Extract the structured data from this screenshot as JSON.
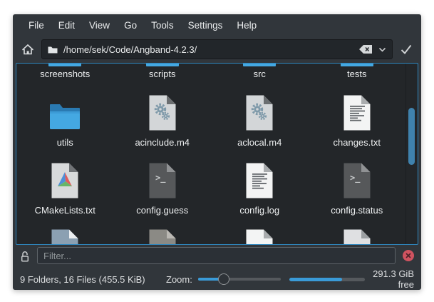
{
  "menu": {
    "items": [
      "File",
      "Edit",
      "View",
      "Go",
      "Tools",
      "Settings",
      "Help"
    ]
  },
  "location_bar": {
    "path": "/home/sek/Code/Angband-4.2.3/",
    "icons": [
      "home-icon",
      "folder-small-icon",
      "backspace-clear-icon",
      "chevron-down-icon",
      "checkmark-icon"
    ]
  },
  "file_grid": {
    "rows": [
      {
        "kind": "scrolled-top",
        "items": [
          {
            "label": "screenshots",
            "icon": "folder-strip"
          },
          {
            "label": "scripts",
            "icon": "folder-strip"
          },
          {
            "label": "src",
            "icon": "folder-strip"
          },
          {
            "label": "tests",
            "icon": "folder-strip"
          }
        ]
      },
      {
        "kind": "full",
        "items": [
          {
            "label": "utils",
            "icon": "folder"
          },
          {
            "label": "acinclude.m4",
            "icon": "gears-doc"
          },
          {
            "label": "aclocal.m4",
            "icon": "gears-doc"
          },
          {
            "label": "changes.txt",
            "icon": "text-doc"
          }
        ]
      },
      {
        "kind": "full",
        "items": [
          {
            "label": "CMakeLists.txt",
            "icon": "cmake-doc"
          },
          {
            "label": "config.guess",
            "icon": "shell-doc"
          },
          {
            "label": "config.log",
            "icon": "text-doc"
          },
          {
            "label": "config.status",
            "icon": "shell-doc"
          }
        ]
      },
      {
        "kind": "scrolled-bottom",
        "items": [
          {
            "icon": "partial-doc",
            "body": "#8ba0b2",
            "fold": "#ebeef0"
          },
          {
            "icon": "partial-doc",
            "body": "#8b8a85",
            "fold": "#bab8b3"
          },
          {
            "icon": "partial-doc",
            "body": "#f3f4f4",
            "fold": "#a9acae"
          },
          {
            "icon": "partial-doc",
            "body": "#dfe0e2",
            "fold": "#9b9fa2"
          }
        ]
      }
    ]
  },
  "filter_bar": {
    "placeholder": "Filter...",
    "icons": [
      "lock-open-icon",
      "close-filter-icon"
    ]
  },
  "status_bar": {
    "summary": "9 Folders, 16 Files (455.5 KiB)",
    "zoom_label": "Zoom:",
    "zoom_value_percent": 31,
    "capacity_used_percent": 70,
    "free_space": "291.3 GiB free"
  },
  "colors": {
    "window_bg": "#31363b",
    "view_bg": "#232629",
    "focus_border": "#2e86bd",
    "folder_blue": "#44a8e2",
    "folder_blue_dark": "#2a7ab2",
    "accent_blue": "#3a9bd8",
    "scroll_thumb": "#3f82ad",
    "close_red": "#cf5360"
  }
}
